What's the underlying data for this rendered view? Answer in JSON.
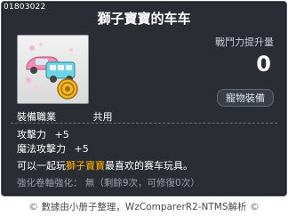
{
  "item": {
    "id": "01803022",
    "name": "獅子寶寶的车车",
    "icon": "toy-car-icon",
    "power_label": "戰鬥力提升量",
    "power_value": "0",
    "pet_equip_label": "寵物裝備",
    "job_label": "裝備職業",
    "job_value": "共用",
    "stats": [
      {
        "label": "攻擊力",
        "value": "+5"
      },
      {
        "label": "魔法攻擊力",
        "value": "+5"
      }
    ],
    "description": {
      "prefix": "可以一起玩",
      "highlight": "獅子寶寶",
      "suffix": "最喜欢的赛车玩具。"
    },
    "enhance": {
      "label": "強化卷軸強化：",
      "value": "無（剩餘9次，可修復0次）"
    }
  },
  "footer": {
    "left_icon": "copyright-icon",
    "text": "數據由小册子整理，WzComparerR2-NTMS解析",
    "right_icon": "copyright-icon"
  },
  "colors": {
    "tooltip_bg": "#2a2d33",
    "highlight": "#ffb400",
    "muted": "#9aa0aa"
  }
}
